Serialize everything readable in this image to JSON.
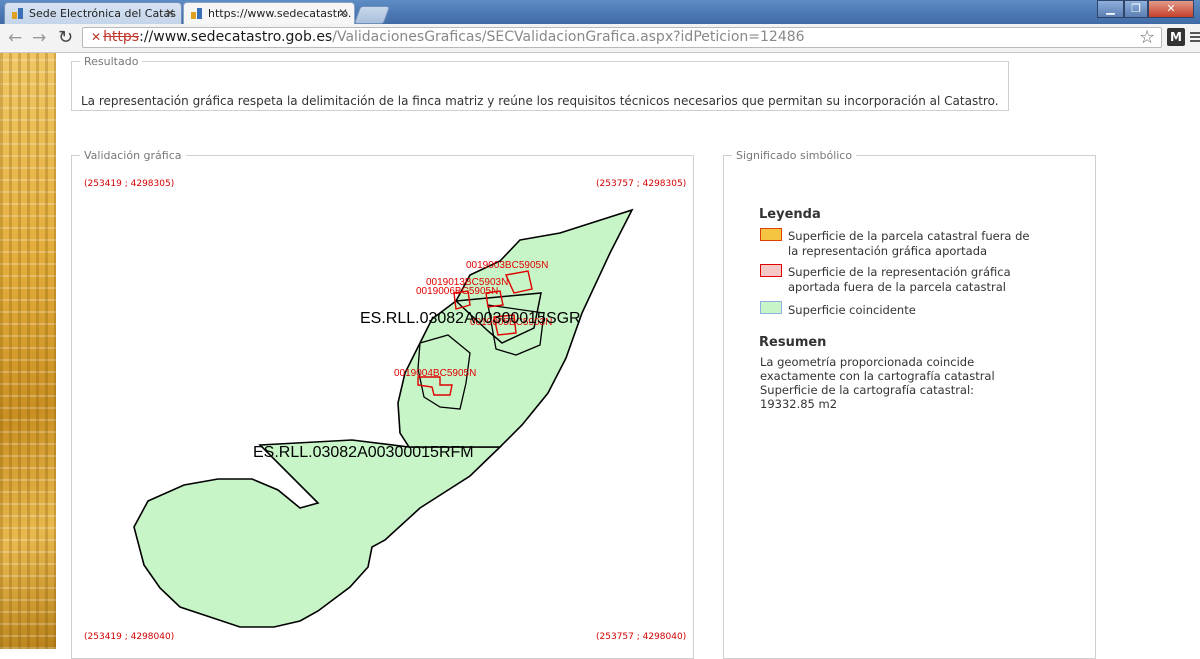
{
  "browser": {
    "tabs": [
      {
        "label": "Sede Electrónica del Catas",
        "active": false
      },
      {
        "label": "https://www.sedecatastro.",
        "active": true
      }
    ],
    "url": {
      "scheme": "https",
      "host": "://www.sedecatastro.gob.es",
      "path": "/ValidacionesGraficas/SECValidacionGrafica.aspx?idPeticion=12486"
    },
    "extension_label": "M"
  },
  "result": {
    "legend": "Resultado",
    "text": "La representación gráfica respeta la delimitación de la finca matriz y reúne los requisitos técnicos necesarios que permitan su incorporación al Catastro."
  },
  "validation": {
    "legend": "Validación gráfica",
    "coords": {
      "top_left": "(253419 ; 4298305)",
      "top_right": "(253757 ; 4298305)",
      "bottom_left": "(253419 ; 4298040)",
      "bottom_right": "(253757 ; 4298040)"
    },
    "parcel_labels": {
      "large_1": "ES.RLL.03082A00300015SGR",
      "large_2": "ES.RLL.03082A00300015RFM",
      "small_1": "0019003BC5905N",
      "small_2": "0019013BC5903N",
      "small_3": "0019006BC5905N",
      "small_4": "0019005BC5903N",
      "small_5": "0019004BC5905N"
    },
    "colors": {
      "coincident_fill": "#c8f5c8",
      "outline": "#000000",
      "parcel_red": "#e00000"
    }
  },
  "symbols": {
    "legend": "Significado simbólico",
    "title": "Leyenda",
    "items": [
      {
        "label": "Superficie de la parcela catastral fuera de la representación gráfica aportada",
        "fill": "#f5c542",
        "border": "#e04000"
      },
      {
        "label": "Superficie de la representación gráfica aportada fuera de la parcela catastral",
        "fill": "#f7c8c8",
        "border": "#e00000"
      },
      {
        "label": "Superficie coincidente",
        "fill": "#c8f5c8",
        "border": "#8fb0e0"
      }
    ],
    "summary_title": "Resumen",
    "summary_lines": [
      "La geometría proporcionada coincide",
      "exactamente con la cartografía catastral",
      "Superficie de la cartografía catastral:",
      "19332.85 m2"
    ]
  }
}
